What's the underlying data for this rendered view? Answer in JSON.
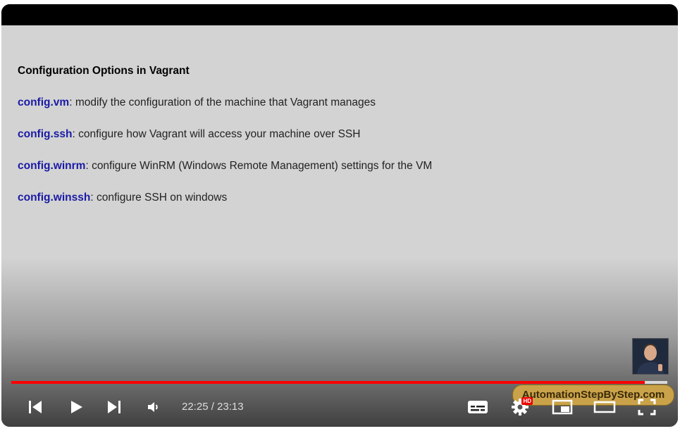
{
  "slide": {
    "title": "Configuration Options in Vagrant",
    "lines": [
      {
        "keyword": "config.vm",
        "text": ": modify the configuration of the machine that Vagrant manages"
      },
      {
        "keyword": "config.ssh",
        "text": ": configure how Vagrant will access your machine over SSH"
      },
      {
        "keyword": "config.winrm",
        "text": ": configure WinRM (Windows Remote Management) settings for the VM"
      },
      {
        "keyword": "config.winssh",
        "text": ": configure SSH on windows"
      }
    ]
  },
  "watermark": {
    "text": "AutomationStepByStep.com"
  },
  "player": {
    "time_display": "22:25 / 23:13",
    "progress_fraction": 0.9655,
    "buffered_fraction": 1.0,
    "hd_badge": "HD",
    "progress_color": "#ff0000",
    "icons": [
      "previous-icon",
      "play-icon",
      "next-icon",
      "volume-icon",
      "subtitles-icon",
      "settings-icon",
      "miniplayer-icon",
      "theater-mode-icon",
      "fullscreen-icon"
    ]
  }
}
